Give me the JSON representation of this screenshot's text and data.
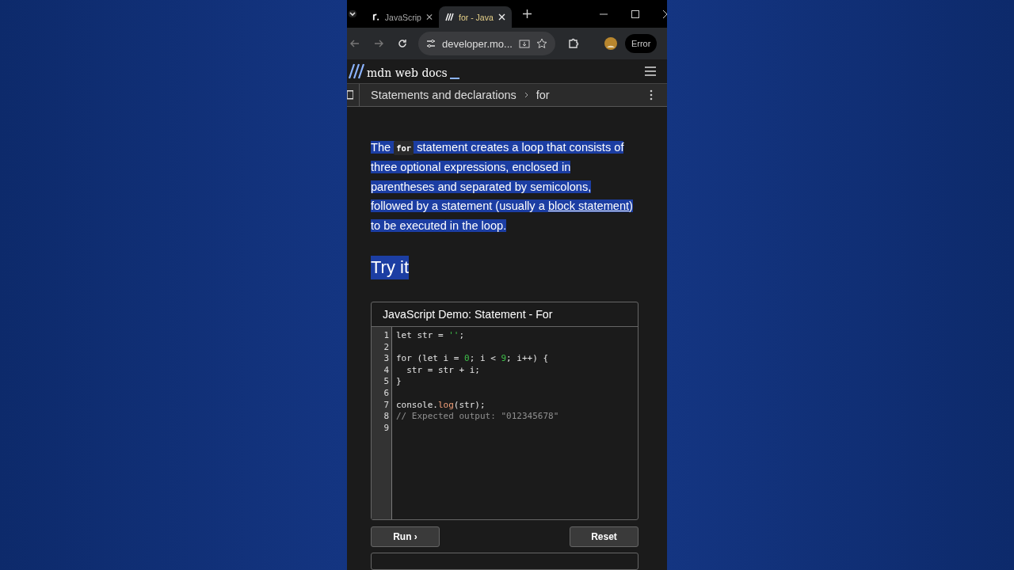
{
  "browser": {
    "tabs": [
      {
        "title": "JavaScrip",
        "selected": false
      },
      {
        "title": "for - Java",
        "selected": true
      }
    ],
    "address": "developer.mo...",
    "profile_button": "Error"
  },
  "site_header": {
    "logo_text": "mdn web docs"
  },
  "breadcrumb": [
    "Statements and declarations",
    "for"
  ],
  "article": {
    "intro": {
      "highlighted": true,
      "parts": [
        {
          "kind": "text",
          "text": "The "
        },
        {
          "kind": "code",
          "text": "for"
        },
        {
          "kind": "text",
          "text": " statement creates a loop that consists of three optional expressions, enclosed in parentheses and separated by semicolons, followed by a statement (usually a "
        },
        {
          "kind": "link",
          "text": "block statement"
        },
        {
          "kind": "text",
          "text": ") to be executed in the loop."
        }
      ]
    },
    "section_heading": {
      "text": "Try it",
      "highlighted": true
    }
  },
  "demo": {
    "title": "JavaScript Demo: Statement - For",
    "lines": [
      {
        "number": "1",
        "tokens": [
          {
            "kind": "plain",
            "text": "let str = "
          },
          {
            "kind": "string",
            "text": "''"
          },
          {
            "kind": "plain",
            "text": ";"
          }
        ]
      },
      {
        "number": "2"
      },
      {
        "number": "3",
        "tokens": [
          {
            "kind": "plain",
            "text": "for (let i = "
          },
          {
            "kind": "number",
            "text": "0"
          },
          {
            "kind": "plain",
            "text": "; i < "
          },
          {
            "kind": "number",
            "text": "9"
          },
          {
            "kind": "plain",
            "text": "; i++) {"
          }
        ]
      },
      {
        "number": "4",
        "tokens": [
          {
            "kind": "plain",
            "text": "  str = str + i;"
          }
        ]
      },
      {
        "number": "5",
        "tokens": [
          {
            "kind": "plain",
            "text": "}"
          }
        ]
      },
      {
        "number": "6"
      },
      {
        "number": "7",
        "tokens": [
          {
            "kind": "plain",
            "text": "console."
          },
          {
            "kind": "function",
            "text": "log"
          },
          {
            "kind": "plain",
            "text": "(str);"
          }
        ]
      },
      {
        "number": "8",
        "tokens": [
          {
            "kind": "comment",
            "text": "// Expected output: \"012345678\""
          }
        ]
      },
      {
        "number": "9"
      }
    ],
    "buttons": [
      {
        "label": "Run ›"
      },
      {
        "label": "Reset"
      }
    ]
  }
}
